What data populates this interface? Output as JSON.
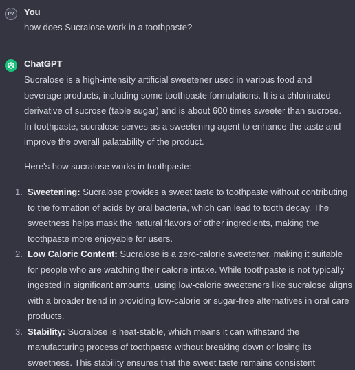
{
  "user_message": {
    "avatar_initials": "PV",
    "author": "You",
    "text": "how does Sucralose work in a toothpaste?"
  },
  "assistant_message": {
    "avatar_icon": "openai-logo-icon",
    "author": "ChatGPT",
    "intro": "Sucralose is a high-intensity artificial sweetener used in various food and beverage products, including some toothpaste formulations. It is a chlorinated derivative of sucrose (table sugar) and is about 600 times sweeter than sucrose. In toothpaste, sucralose serves as a sweetening agent to enhance the taste and improve the overall palatability of the product.",
    "lead": "Here's how sucralose works in toothpaste:",
    "points": [
      {
        "number": "1.",
        "heading": "Sweetening:",
        "body": " Sucralose provides a sweet taste to toothpaste without contributing to the formation of acids by oral bacteria, which can lead to tooth decay. The sweetness helps mask the natural flavors of other ingredients, making the toothpaste more enjoyable for users."
      },
      {
        "number": "2.",
        "heading": "Low Caloric Content:",
        "body": " Sucralose is a zero-calorie sweetener, making it suitable for people who are watching their calorie intake. While toothpaste is not typically ingested in significant amounts, using low-calorie sweeteners like sucralose aligns with a broader trend in providing low-calorie or sugar-free alternatives in oral care products."
      },
      {
        "number": "3.",
        "heading": "Stability:",
        "body": " Sucralose is heat-stable, which means it can withstand the manufacturing process of toothpaste without breaking down or losing its sweetness. This stability ensures that the sweet taste remains consistent throughout the product's shelf life."
      }
    ]
  },
  "colors": {
    "background": "#343541",
    "assistant_avatar": "#19c37d",
    "text_primary": "#ececf1",
    "text_body": "#d1d5db"
  }
}
